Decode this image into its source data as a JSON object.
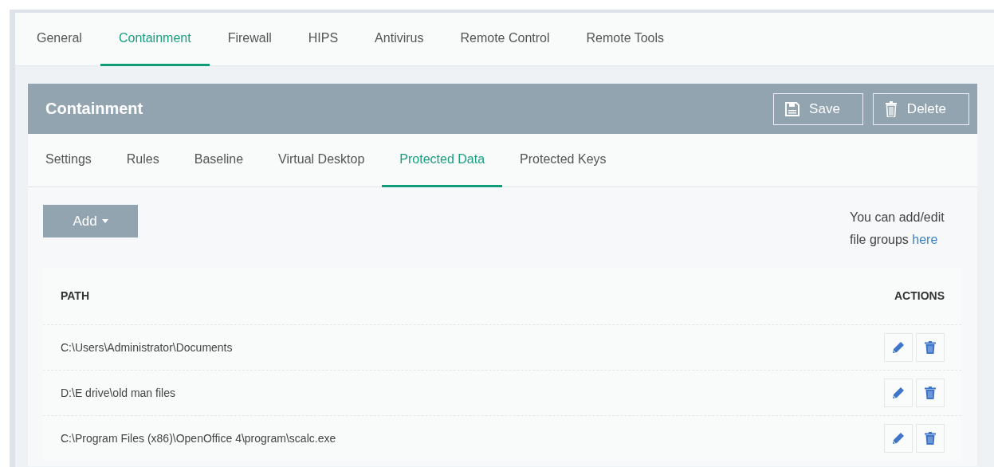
{
  "tabs": [
    {
      "label": "General",
      "selected": false
    },
    {
      "label": "Containment",
      "selected": true
    },
    {
      "label": "Firewall",
      "selected": false
    },
    {
      "label": "HIPS",
      "selected": false
    },
    {
      "label": "Antivirus",
      "selected": false
    },
    {
      "label": "Remote Control",
      "selected": false
    },
    {
      "label": "Remote Tools",
      "selected": false
    }
  ],
  "panel": {
    "title": "Containment",
    "buttons": [
      {
        "kind": "save",
        "label": "Save"
      },
      {
        "kind": "delete",
        "label": "Delete"
      }
    ]
  },
  "subtabs": [
    {
      "label": "Settings",
      "selected": false
    },
    {
      "label": "Rules",
      "selected": false
    },
    {
      "label": "Baseline",
      "selected": false
    },
    {
      "label": "Virtual Desktop",
      "selected": false
    },
    {
      "label": "Protected Data",
      "selected": true
    },
    {
      "label": "Protected Keys",
      "selected": false
    }
  ],
  "add_button": {
    "label": "Add"
  },
  "hint": {
    "text": "You can add/edit file groups",
    "link": "here"
  },
  "table": {
    "columns": [
      "PATH",
      "ACTIONS"
    ],
    "rows": [
      {
        "path": "C:\\Users\\Administrator\\Documents"
      },
      {
        "path": "D:\\E drive\\old man files"
      },
      {
        "path": "C:\\Program Files (x86)\\OpenOffice 4\\program\\scalc.exe"
      }
    ]
  }
}
